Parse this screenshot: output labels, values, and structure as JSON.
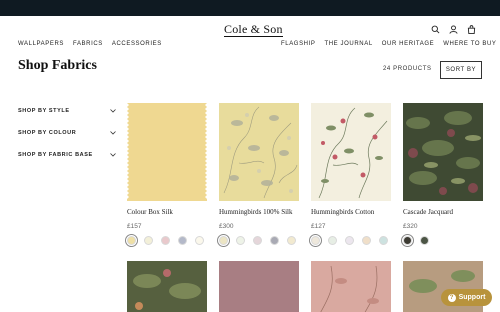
{
  "brand": {
    "logo": "Cole & Son"
  },
  "nav_left": [
    "Wallpapers",
    "Fabrics",
    "Accessories"
  ],
  "nav_right": [
    "Flagship",
    "The Journal",
    "Our Heritage",
    "Where to Buy"
  ],
  "page": {
    "title": "Shop Fabrics",
    "count": "24 PRODUCTS",
    "sort_label": "SORT BY"
  },
  "filters": [
    "SHOP BY STYLE",
    "SHOP BY COLOUR",
    "SHOP BY FABRIC BASE"
  ],
  "products": [
    {
      "name": "Colour Box Silk",
      "price": "£157",
      "swatches": [
        "#efe0a6",
        "#f3f0d9",
        "#e9c9cc",
        "#b4b9c9",
        "#fbf8ec"
      ]
    },
    {
      "name": "Hummingbirds 100% Silk",
      "price": "£300",
      "swatches": [
        "#ece5c4",
        "#eef3e8",
        "#e5d6da",
        "#a9aab4",
        "#f2ead0"
      ]
    },
    {
      "name": "Hummingbirds Cotton",
      "price": "£127",
      "swatches": [
        "#eee8dc",
        "#e7eee5",
        "#ece6ee",
        "#f0dfc9",
        "#cde2e0"
      ]
    },
    {
      "name": "Cascade Jacquard",
      "price": "£320",
      "swatches": [
        "#3d3b33",
        "#4c5545"
      ]
    }
  ],
  "support": {
    "label": "Support",
    "icon": "question-icon"
  },
  "colors": {
    "topbar": "#0f1a22",
    "support": "#b8933c"
  }
}
